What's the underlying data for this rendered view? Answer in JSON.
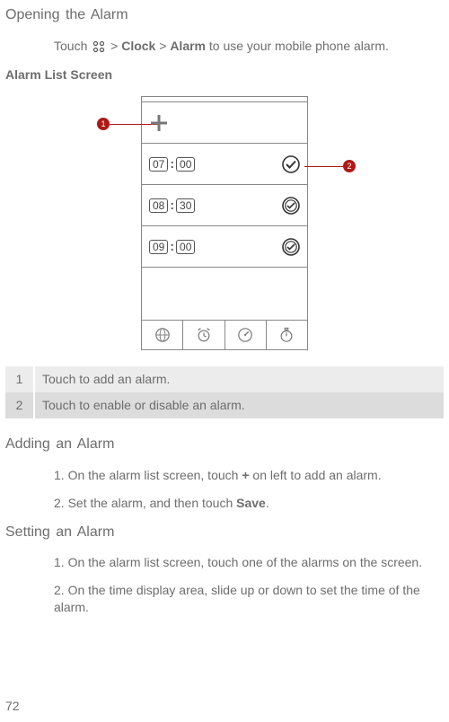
{
  "headings": {
    "opening": "Opening the Alarm",
    "listScreen": "Alarm List Screen",
    "adding": "Adding an Alarm",
    "setting": "Setting an Alarm"
  },
  "intro": {
    "prefix": "Touch ",
    "sep1": " > ",
    "clock": "Clock",
    "sep2": " > ",
    "alarm": "Alarm",
    "suffix": " to use your mobile phone alarm."
  },
  "alarms": [
    {
      "h": "07",
      "m": "00",
      "enabled": true
    },
    {
      "h": "08",
      "m": "30",
      "enabled": false
    },
    {
      "h": "09",
      "m": "00",
      "enabled": false
    }
  ],
  "callouts": {
    "c1": "1",
    "c2": "2"
  },
  "legend": {
    "r1num": "1",
    "r1text": "Touch to add an alarm.",
    "r2num": "2",
    "r2text": "Touch to enable or disable an alarm."
  },
  "addingSteps": {
    "s1a": "1. On the alarm list screen, touch ",
    "s1b": "+",
    "s1c": " on left to add an alarm.",
    "s2a": "2. Set the alarm, and then touch ",
    "s2b": "Save",
    "s2c": "."
  },
  "settingSteps": {
    "s1": "1. On the alarm list screen, touch one of the alarms on the screen.",
    "s2": "2. On the time display area, slide up or down to set the time of the alarm."
  },
  "pageNumber": "72"
}
